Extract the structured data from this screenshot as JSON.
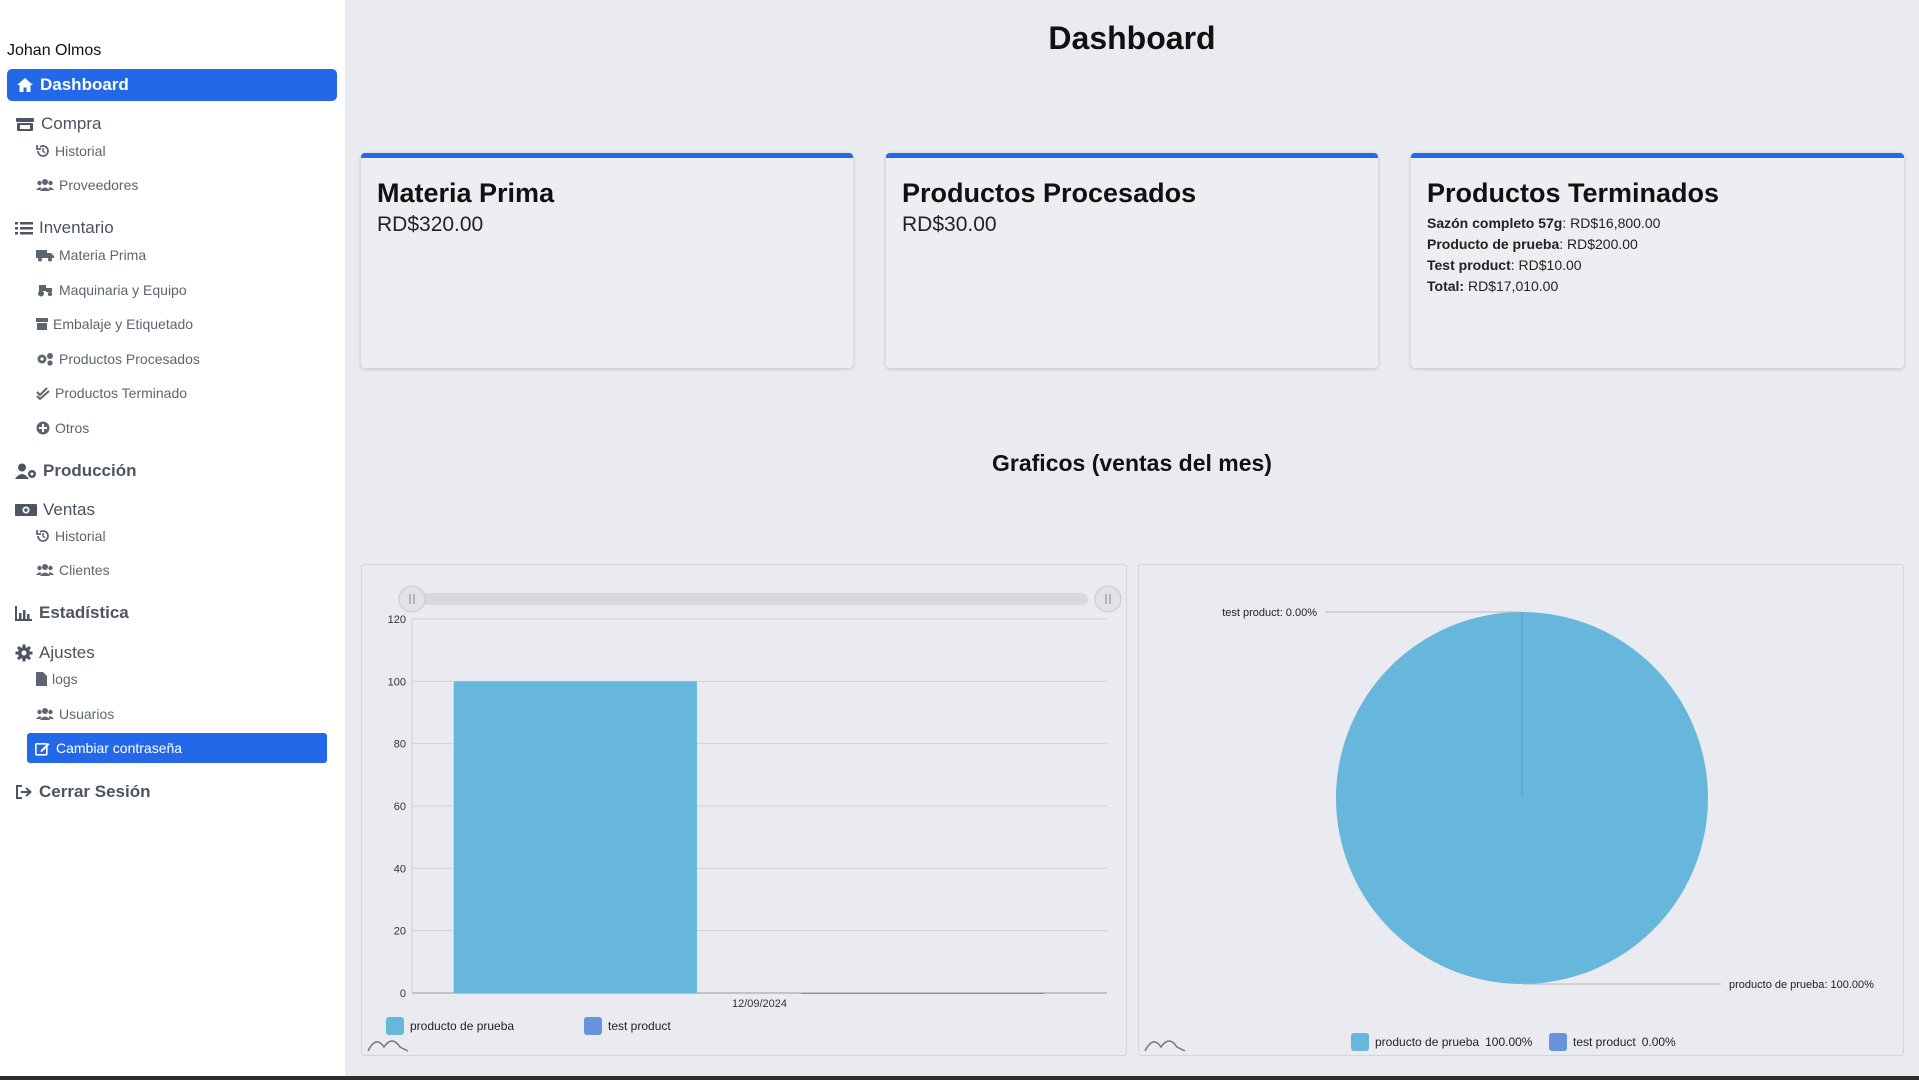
{
  "user": {
    "name": "Johan Olmos"
  },
  "sidebar": {
    "dashboard": "Dashboard",
    "compra": {
      "label": "Compra",
      "items": [
        "Historial",
        "Proveedores"
      ]
    },
    "inventario": {
      "label": "Inventario",
      "items": [
        "Materia Prima",
        "Maquinaria y Equipo",
        "Embalaje y Etiquetado",
        "Productos Procesados",
        "Productos Terminado",
        "Otros"
      ]
    },
    "produccion": "Producción",
    "ventas": {
      "label": "Ventas",
      "items": [
        "Historial",
        "Clientes"
      ]
    },
    "estadistica": "Estadística",
    "ajustes": {
      "label": "Ajustes",
      "items": [
        "logs",
        "Usuarios",
        "Cambiar contraseña"
      ]
    },
    "cerrar": "Cerrar Sesión"
  },
  "main": {
    "title": "Dashboard",
    "cards": [
      {
        "title": "Materia Prima",
        "amount": "RD$320.00"
      },
      {
        "title": "Productos Procesados",
        "amount": "RD$30.00"
      },
      {
        "title": "Productos Terminados",
        "lines": [
          {
            "label": "Sazón completo 57g",
            "value": "RD$16,800.00"
          },
          {
            "label": "Producto de prueba",
            "value": "RD$200.00"
          },
          {
            "label": "Test product",
            "value": "RD$10.00"
          },
          {
            "label": "Total:",
            "value": "RD$17,010.00"
          }
        ]
      }
    ],
    "charts_title": "Graficos (ventas del mes)"
  },
  "colors": {
    "accent": "#2368e8",
    "series1": "#67b6dc",
    "series2": "#6794dc"
  },
  "chart_data": [
    {
      "type": "bar",
      "categories": [
        "12/09/2024"
      ],
      "series": [
        {
          "name": "producto  de prueba",
          "values": [
            100
          ]
        },
        {
          "name": "test product",
          "values": [
            0
          ]
        }
      ],
      "ylim": [
        0,
        120
      ],
      "yticks": [
        0,
        20,
        40,
        60,
        80,
        100,
        120
      ],
      "legend": "bottom-left"
    },
    {
      "type": "pie",
      "slices": [
        {
          "name": "producto  de prueba",
          "value": 100,
          "label": "producto  de prueba: 100.00%",
          "legend": "100.00%"
        },
        {
          "name": "test product",
          "value": 0,
          "label": "test product: 0.00%",
          "legend": "0.00%"
        }
      ],
      "legend": "bottom"
    }
  ]
}
